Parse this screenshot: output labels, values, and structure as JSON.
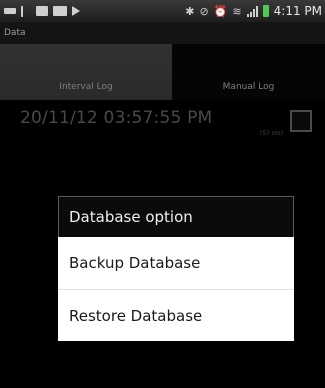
{
  "status_bar": {
    "time": "4:11 PM",
    "icons": [
      "keyboard-icon",
      "usb-icon",
      "image-icon",
      "gallery-icon",
      "play-icon",
      "bluetooth-icon",
      "mute-icon",
      "alarm-icon",
      "wifi-icon",
      "signal-icon",
      "battery-icon"
    ]
  },
  "app": {
    "title": "Data"
  },
  "tabs": [
    {
      "label": "Interval Log",
      "selected": true
    },
    {
      "label": "Manual Log",
      "selected": false
    }
  ],
  "log_entry": {
    "timestamp": "20/11/12 03:57:55 PM",
    "detail": "(57 ms)"
  },
  "dialog": {
    "title": "Database option",
    "items": [
      {
        "label": "Backup Database"
      },
      {
        "label": "Restore Database"
      }
    ]
  },
  "colors": {
    "battery": "#4fc94f",
    "tab_selected_bg": "#2e2e2e",
    "dialog_bg": "#ffffff"
  }
}
